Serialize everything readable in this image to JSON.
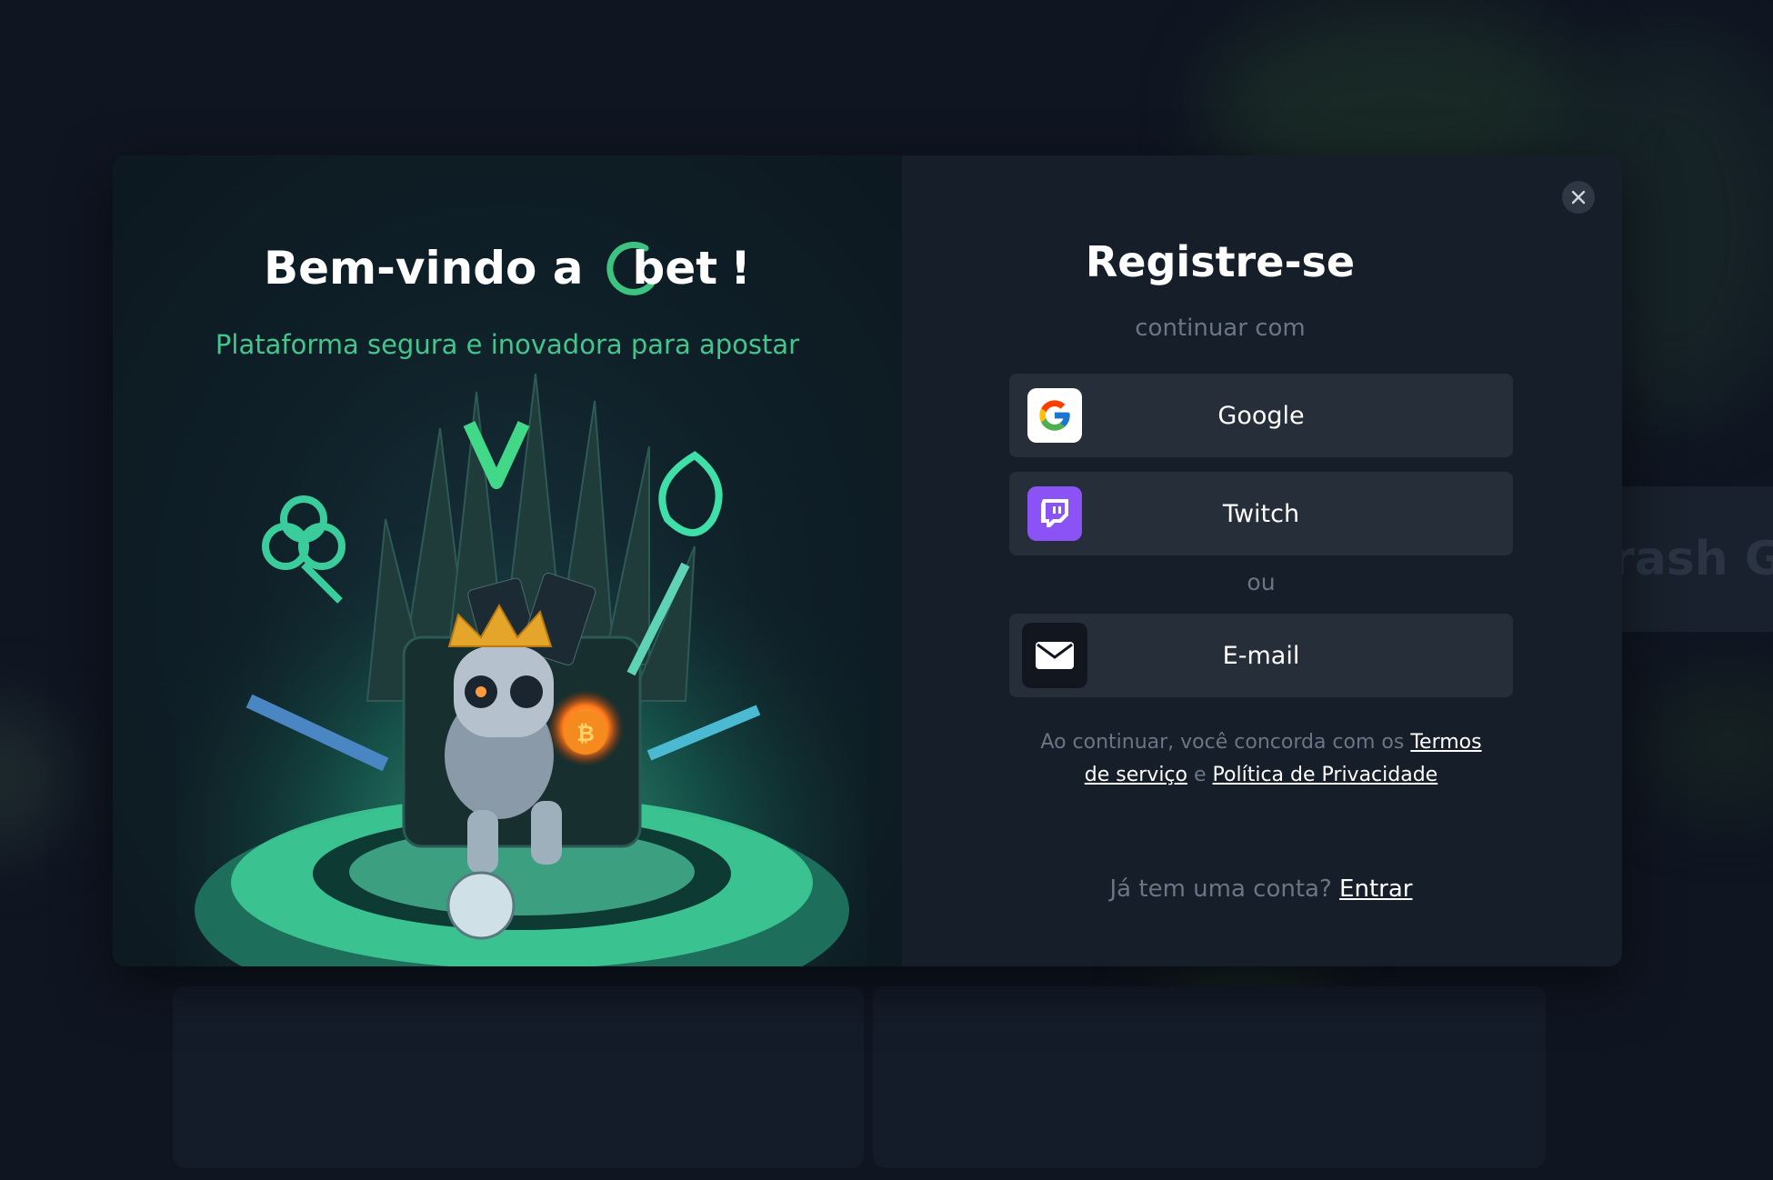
{
  "background": {
    "faded_text": "rash Ga"
  },
  "promo": {
    "title_prefix": "Bem-vindo a",
    "logo_text": "bet",
    "title_suffix": "!",
    "subtitle": "Plataforma segura e inovadora para apostar"
  },
  "register": {
    "title": "Registre-se",
    "subtitle": "continuar com",
    "google_label": "Google",
    "twitch_label": "Twitch",
    "or_label": "ou",
    "email_label": "E-mail",
    "terms_prefix": "Ao continuar, você concorda com os",
    "terms_link": "Termos de serviço",
    "terms_and": "e",
    "privacy_link": "Política de Privacidade",
    "login_prompt": "Já tem uma conta?",
    "login_link": "Entrar"
  },
  "icons": {
    "close": "close-icon",
    "google": "google-icon",
    "twitch": "twitch-icon",
    "email": "envelope-icon"
  },
  "colors": {
    "accent_green": "#43c58b",
    "twitch_purple": "#8b52f5",
    "modal_bg": "#161e29",
    "button_bg": "#262e39"
  }
}
